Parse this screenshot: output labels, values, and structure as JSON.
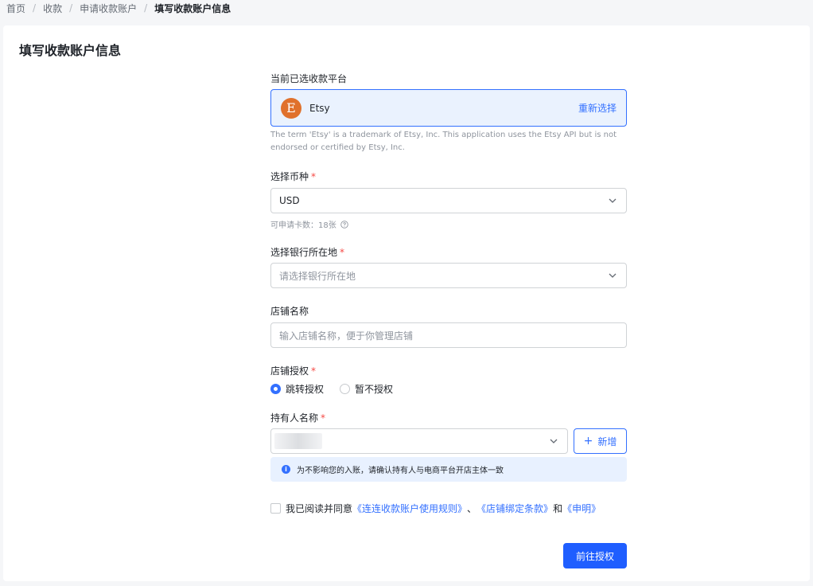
{
  "breadcrumb": {
    "items": [
      "首页",
      "收款",
      "申请收款账户"
    ],
    "current": "填写收款账户信息",
    "separator": "/"
  },
  "page_title": "填写收款账户信息",
  "platform": {
    "label": "当前已选收款平台",
    "logo_letter": "E",
    "name": "Etsy",
    "reselect": "重新选择",
    "note": "The term 'Etsy' is a trademark of Etsy, Inc. This application uses the Etsy API but is not endorsed or certified by Etsy, Inc."
  },
  "currency": {
    "label": "选择币种",
    "required_mark": "*",
    "value": "USD",
    "helper": "可申请卡数：18张"
  },
  "bank_location": {
    "label": "选择银行所在地",
    "required_mark": "*",
    "placeholder": "请选择银行所在地"
  },
  "store_name": {
    "label": "店铺名称",
    "placeholder": "输入店铺名称，便于你管理店铺"
  },
  "store_auth": {
    "label": "店铺授权",
    "required_mark": "*",
    "options": [
      {
        "label": "跳转授权",
        "selected": true
      },
      {
        "label": "暂不授权",
        "selected": false
      }
    ]
  },
  "holder": {
    "label": "持有人名称",
    "required_mark": "*",
    "add_button": "新增",
    "info": "为不影响您的入账，请确认持有人与电商平台开店主体一致"
  },
  "agreement": {
    "prefix": "我已阅读并同意",
    "link1": "《连连收款账户使用规则》",
    "sep1": "、",
    "link2": "《店铺绑定条款》",
    "sep2": "和",
    "link3": "《申明》"
  },
  "submit": "前往授权",
  "colors": {
    "primary": "#3370ff",
    "button": "#1f5eff",
    "etsy": "#e0712c",
    "required": "#f54a45"
  }
}
